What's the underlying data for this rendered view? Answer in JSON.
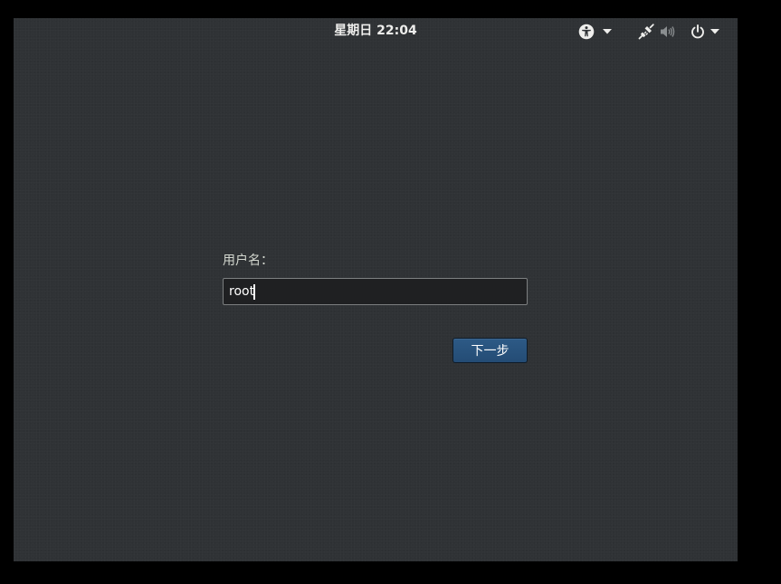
{
  "topbar": {
    "clock": "星期日 22:04",
    "icons": {
      "accessibility": "accessibility-icon",
      "accessibility_menu_arrow": "chevron-down-icon",
      "network": "network-wired-icon",
      "volume": "volume-icon",
      "power": "power-icon",
      "system_menu_arrow": "chevron-down-icon"
    }
  },
  "login": {
    "username_label": "用户名：",
    "username_value": "root",
    "next_button_label": "下一步"
  },
  "colors": {
    "background": "#2f3235",
    "accent_button": "#2a5580",
    "panel_text": "#eeeeec"
  }
}
